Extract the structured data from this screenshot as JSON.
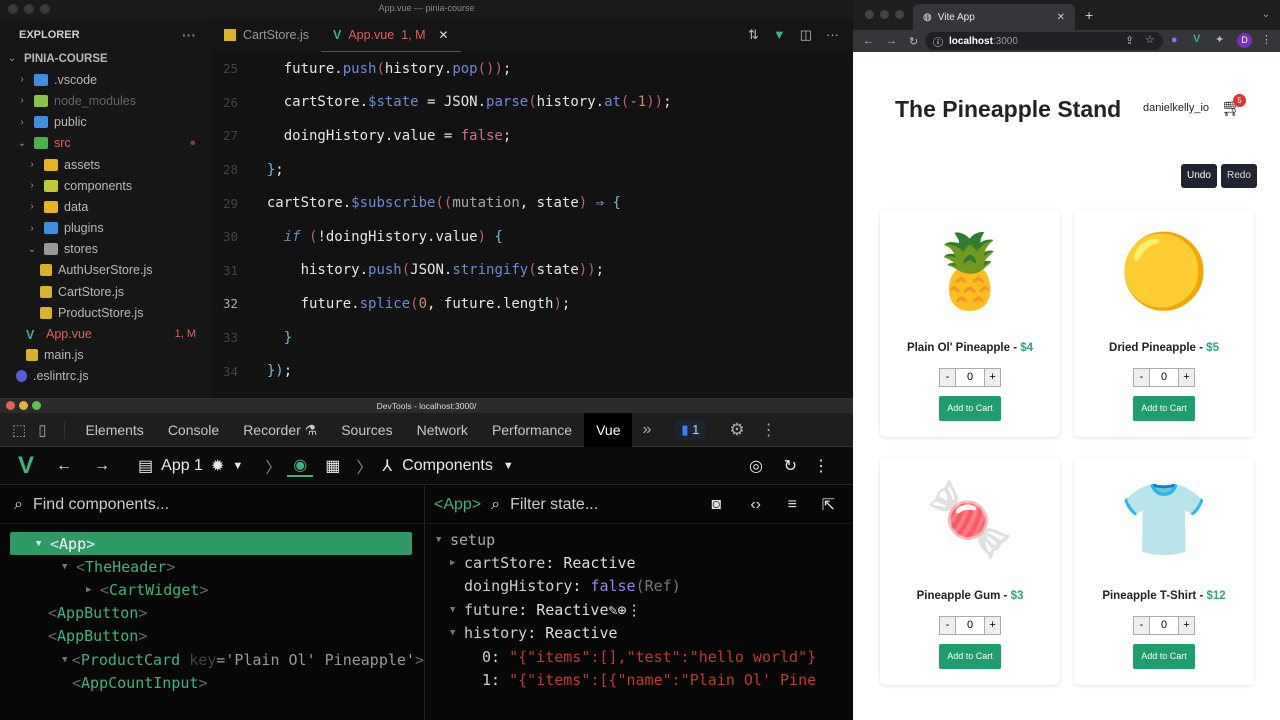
{
  "vscode": {
    "window_title": "App.vue — pinia-course",
    "explorer_label": "EXPLORER",
    "project": "PINIA-COURSE",
    "tree": [
      {
        "label": ".vscode",
        "depth": 1,
        "type": "folder",
        "color": "#3f8ee0",
        "text": "#b8b8b8"
      },
      {
        "label": "node_modules",
        "depth": 1,
        "type": "folder",
        "color": "#8bc34a",
        "text": "#666"
      },
      {
        "label": "public",
        "depth": 1,
        "type": "folder",
        "color": "#3f8ee0",
        "text": "#b8b8b8"
      },
      {
        "label": "src",
        "depth": 1,
        "type": "folder-open",
        "color": "#4caf50",
        "text": "#e0605a",
        "badge": "●",
        "badge_color": "#8a3a3a"
      },
      {
        "label": "assets",
        "depth": 2,
        "type": "folder",
        "color": "#e6b422",
        "text": "#b8b8b8"
      },
      {
        "label": "components",
        "depth": 2,
        "type": "folder",
        "color": "#c0ca33",
        "text": "#b8b8b8"
      },
      {
        "label": "data",
        "depth": 2,
        "type": "folder",
        "color": "#e6b422",
        "text": "#b8b8b8"
      },
      {
        "label": "plugins",
        "depth": 2,
        "type": "folder",
        "color": "#3f8ee0",
        "text": "#b8b8b8"
      },
      {
        "label": "stores",
        "depth": 2,
        "type": "folder-open",
        "color": "#999",
        "text": "#b8b8b8"
      },
      {
        "label": "AuthUserStore.js",
        "depth": 3,
        "type": "js",
        "text": "#b8b8b8"
      },
      {
        "label": "CartStore.js",
        "depth": 3,
        "type": "js",
        "text": "#b8b8b8"
      },
      {
        "label": "ProductStore.js",
        "depth": 3,
        "type": "js",
        "text": "#b8b8b8"
      },
      {
        "label": "App.vue",
        "depth": 2,
        "type": "vue",
        "text": "#e0605a",
        "badge": "1, M",
        "badge_color": "#e0605a"
      },
      {
        "label": "main.js",
        "depth": 2,
        "type": "js",
        "text": "#b8b8b8"
      },
      {
        "label": ".eslintrc.js",
        "depth": 1,
        "type": "eslint",
        "text": "#b8b8b8"
      }
    ],
    "tabs": [
      {
        "label": "CartStore.js",
        "icon": "js"
      },
      {
        "label": "App.vue",
        "status": "1, M",
        "icon": "vue",
        "active": true
      }
    ],
    "code": [
      {
        "n": "25",
        "html": "    future.<span class='k-fn'>push</span><span class='k-p'>(</span>history.<span class='k-fn'>pop</span><span class='k-p'>())</span>;"
      },
      {
        "n": "26",
        "html": "    cartStore.<span class='k-fn'>$state</span> = JSON.<span class='k-fn'>parse</span><span class='k-p'>(</span>history.<span class='k-fn'>at</span><span class='k-p'>(</span><span class='k-num'>-1</span><span class='k-p'>))</span>;"
      },
      {
        "n": "27",
        "html": "    doingHistory.value = <span class='k-false'>false</span>;"
      },
      {
        "n": "28",
        "html": "  <span class='k-br'>}</span>;"
      },
      {
        "n": "29",
        "html": "  cartStore.<span class='k-fn'>$subscribe</span><span class='k-p'>((</span><span class='k-par'>mutation</span>, state<span class='k-p'>)</span> <span class='k-arr'>⇒</span> <span class='k-br'>{</span>"
      },
      {
        "n": "30",
        "html": "    <span class='k-kw'>if</span> <span class='k-p'>(</span>!doingHistory.value<span class='k-p'>)</span> <span class='k-br'>{</span>"
      },
      {
        "n": "31",
        "html": "      history.<span class='k-fn'>push</span><span class='k-p'>(</span>JSON.<span class='k-fn'>stringify</span><span class='k-p'>(</span>state<span class='k-p'>))</span>;"
      },
      {
        "n": "32",
        "html": "      future.<span class='k-fn'>splice</span><span class='k-p'>(</span><span class='k-num'>0</span>, future.length<span class='k-p'>)</span>;",
        "cur": true
      },
      {
        "n": "33",
        "html": "    <span class='k-br'>}</span>"
      },
      {
        "n": "34",
        "html": "  <span class='k-br'>})</span>;"
      }
    ]
  },
  "devtools": {
    "title": "DevTools - localhost:3000/",
    "tabs": [
      "Elements",
      "Console",
      "Recorder ⚗",
      "Sources",
      "Network",
      "Performance",
      "Vue"
    ],
    "active_tab": "Vue",
    "more": "»",
    "issues_count": "1",
    "vue": {
      "app": "App 1",
      "section": "Components",
      "find_placeholder": "Find components...",
      "filter_placeholder": "Filter state...",
      "selected": "<App>",
      "components": [
        {
          "name": "App",
          "depth": 0,
          "toggle": "▼",
          "selected": true
        },
        {
          "name": "TheHeader",
          "depth": 1,
          "toggle": "▼"
        },
        {
          "name": "CartWidget",
          "depth": 2,
          "toggle": "▶"
        },
        {
          "name": "AppButton",
          "depth": 1
        },
        {
          "name": "AppButton",
          "depth": 1
        },
        {
          "name": "ProductCard",
          "depth": 1,
          "toggle": "▼",
          "key": "'Plain Ol' Pineapple'"
        },
        {
          "name": "AppCountInput",
          "depth": 2
        }
      ],
      "state_section": "setup",
      "state": [
        {
          "key": "cartStore",
          "value": "Reactive",
          "toggle": "▶"
        },
        {
          "key": "doingHistory",
          "value": "false",
          "suffix": "(Ref)",
          "bool": true
        },
        {
          "key": "future",
          "value": "Reactive",
          "toggle": "▼",
          "hover": true
        },
        {
          "key": "history",
          "value": "Reactive",
          "toggle": "▼"
        }
      ],
      "history_items": [
        {
          "idx": "0",
          "value": "\"{\"items\":[],\"test\":\"hello world\"}"
        },
        {
          "idx": "1",
          "value": "\"{\"items\":[{\"name\":\"Plain Ol' Pine"
        }
      ]
    }
  },
  "browser": {
    "tab_title": "Vite App",
    "url_host": "localhost",
    "url_port": ":3000",
    "profile": "D",
    "site": {
      "title": "The Pineapple Stand",
      "user": "danielkelly_io",
      "cart_count": "5",
      "undo": "Undo",
      "redo": "Redo",
      "products": [
        {
          "name": "Plain Ol' Pineapple",
          "price": "$4",
          "qty": "0",
          "emoji": "🍍"
        },
        {
          "name": "Dried Pineapple",
          "price": "$5",
          "qty": "0",
          "emoji": "🟡"
        },
        {
          "name": "Pineapple Gum",
          "price": "$3",
          "qty": "0",
          "emoji": "🍬"
        },
        {
          "name": "Pineapple T-Shirt",
          "price": "$12",
          "qty": "0",
          "emoji": "👕"
        }
      ],
      "add_label": "Add to Cart"
    }
  }
}
